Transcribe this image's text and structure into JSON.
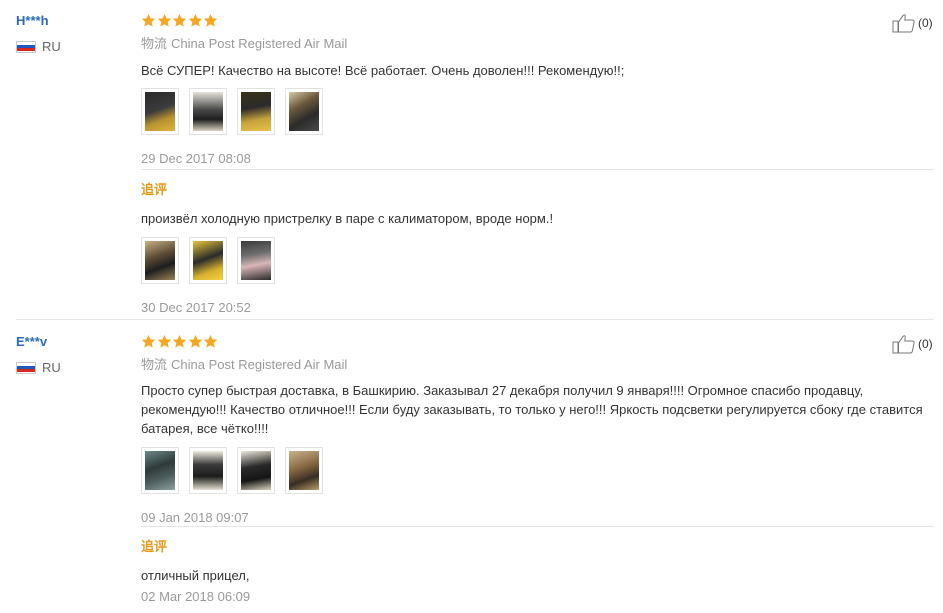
{
  "reviews": [
    {
      "user": "H***h",
      "country": "RU",
      "shipping_label": "物流",
      "shipping": "China Post Registered Air Mail",
      "text": "Всё СУПЕР! Качество на высоте! Всё работает. Очень доволен!!! Рекомендую!!;",
      "date": "29 Dec 2017 08:08",
      "helpful_count": "(0)",
      "rating": 5,
      "append_label": "追评",
      "append_text": "произвёл холодную пристрелку в паре с калиматором, вроде норм.!",
      "append_date": "30 Dec 2017 20:52"
    },
    {
      "user": "E***v",
      "country": "RU",
      "shipping_label": "物流",
      "shipping": "China Post Registered Air Mail",
      "text": "Просто супер быстрая доставка, в Башкирию. Заказывал 27 декабря получил 9 января!!!! Огромное спасибо продавцу, рекомендую!!! Качество отличное!!! Если буду заказывать, то только у него!!! Яркость подсветки регулируется сбоку где ставится батарея, все чётко!!!!",
      "date": "09 Jan 2018 09:07",
      "helpful_count": "(0)",
      "rating": 5,
      "append_label": "追评",
      "append_text": "отличный прицел,",
      "append_date": "02 Mar 2018 06:09"
    }
  ],
  "colors": {
    "star": "#f5a623",
    "username": "#2a6ab8",
    "append_label": "#e69a1c",
    "muted": "#999999"
  }
}
